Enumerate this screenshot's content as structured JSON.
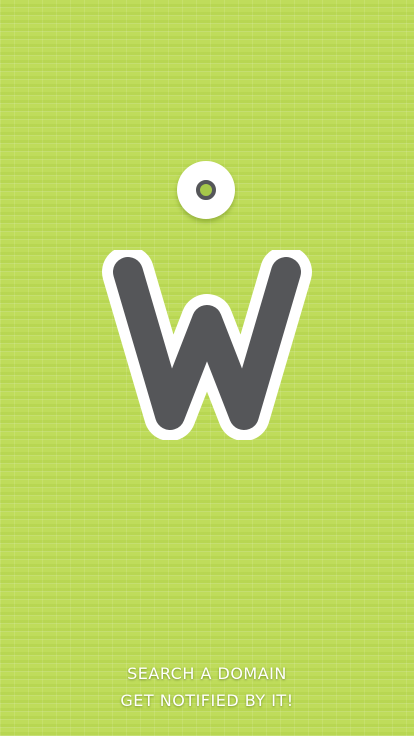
{
  "app": {
    "logo_letter": "W"
  },
  "splash": {
    "tagline_line1": "SEARCH A DOMAIN",
    "tagline_line2": "GET NOTIFIED BY IT!"
  },
  "colors": {
    "background": "#bfdc5b",
    "logo_fill": "#555659",
    "logo_outline": "#ffffff"
  },
  "icons": {
    "dot": "ring-dot-icon",
    "logo": "w-letter-logo-icon"
  }
}
